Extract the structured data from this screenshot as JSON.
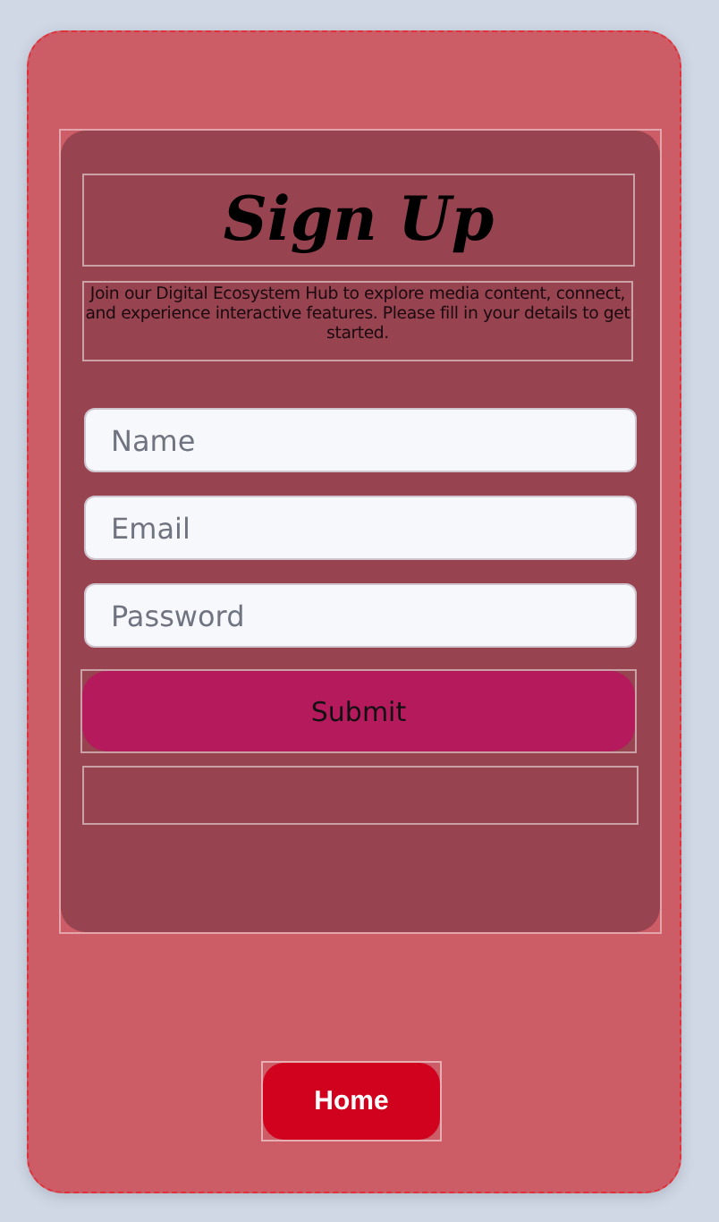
{
  "form": {
    "title": "Sign Up",
    "description": "Join our Digital Ecosystem Hub to explore media content, connect, and experience interactive features. Please fill in your details to get started.",
    "fields": [
      {
        "placeholder": "Name"
      },
      {
        "placeholder": "Email"
      },
      {
        "placeholder": "Password"
      }
    ],
    "submit": "Submit"
  },
  "home_button": "Home"
}
